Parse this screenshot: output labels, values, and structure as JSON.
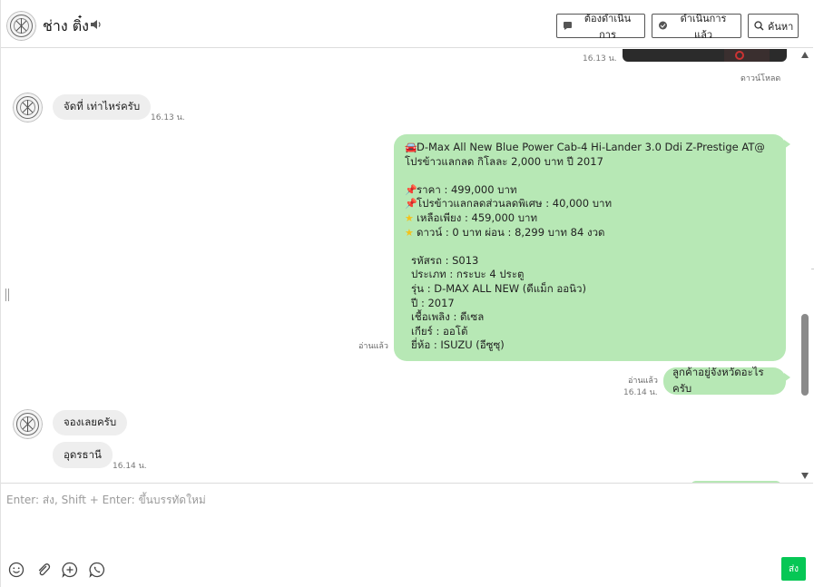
{
  "header": {
    "contact_name": "ช่าง ติ๋ง",
    "btn_todo": "ต้องดำเนินการ",
    "btn_done": "ดำเนินการแล้ว",
    "btn_search": "ค้นหา"
  },
  "messages": {
    "img_time": "16.13 น.",
    "download": "ดาวน์โหลด",
    "m1_text": "จัดที่ เท่าไหร่ครับ",
    "m1_time": "16.13 น.",
    "big_lines": [
      "D-Max All New Blue Power Cab-4 Hi-Lander 3.0 Ddi Z-Prestige AT@",
      "โปรข้าวแลกลด กิโลละ 2,000 บาท ปี 2017",
      "ราคา : 499,000 บาท",
      "โปรข้าวแลกลดส่วนลดพิเศษ : 40,000 บาท",
      "เหลือเพียง : 459,000 บาท",
      "ดาวน์ : 0 บาท ผ่อน : 8,299 บาท 84 งวด",
      "รหัสรถ : S013",
      "ประเภท : กระบะ 4 ประตู",
      "รุ่น : D-MAX ALL NEW (ดีแม็ก ออนิว)",
      "ปี : 2017",
      "เชื้อเพลิง : ดีเซล",
      "เกียร์ : ออโต้",
      "ยี่ห้อ : ISUZU (อีซูซุ)"
    ],
    "big_read": "อ่านแล้ว",
    "m3_text": "ลูกค้าอยู่จังหวัดอะไรครับ",
    "m3_read": "อ่านแล้ว",
    "m3_time": "16.14 น.",
    "m4_text": "จองเลยครับ",
    "m5_text": "อุดรธานี",
    "m5_time": "16.14 น."
  },
  "composer": {
    "placeholder": "Enter: ส่ง, Shift + Enter: ขึ้นบรรทัดใหม่",
    "send_label": "ส่ง"
  },
  "icons": {
    "car": "car-icon",
    "pin": "pushpin-icon",
    "star": "star-icon"
  },
  "colors": {
    "outgoing_bubble": "#b7e8b5",
    "incoming_bubble": "#eeeeee",
    "send_button": "#06c755"
  }
}
